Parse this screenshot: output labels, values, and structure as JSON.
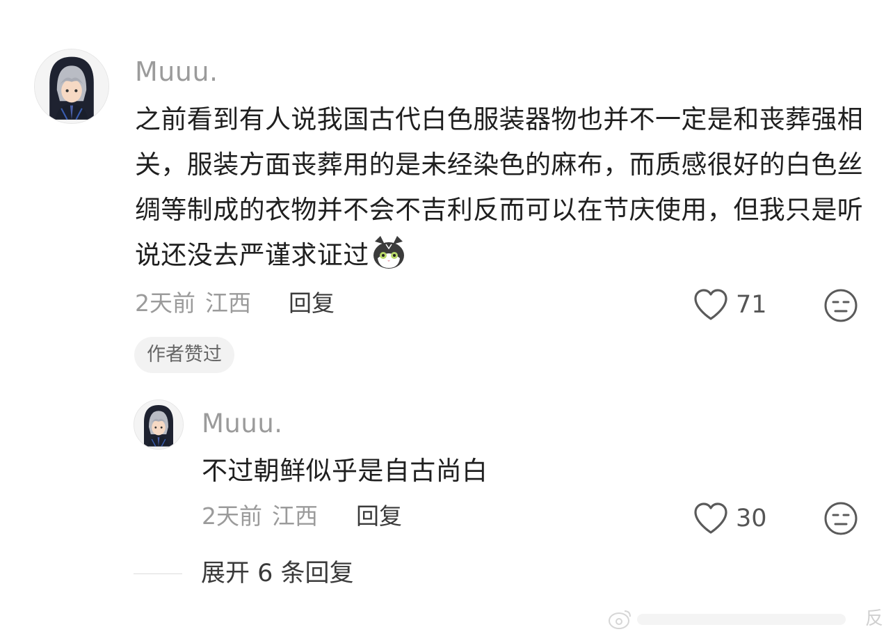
{
  "comment": {
    "username": "Muuu.",
    "text": "之前看到有人说我国古代白色服装器物也并不一定是和丧葬强相关，服装方面丧葬用的是未经染色的麻布，而质感很好的白色丝绸等制成的衣物并不会不吉利反而可以在节庆使用，但我只是听说还没去严谨求证过",
    "emoji": "cat-emoji",
    "time": "2天前",
    "location": "江西",
    "reply_label": "回复",
    "likes": "71",
    "badge": "作者赞过"
  },
  "reply": {
    "username": "Muuu.",
    "text": "不过朝鲜似乎是自古尚白",
    "time": "2天前",
    "location": "江西",
    "reply_label": "回复",
    "likes": "30"
  },
  "expand": {
    "label": "展开 6 条回复"
  },
  "watermark": {
    "text": "反"
  },
  "colors": {
    "secondary_text": "#9b9b9b",
    "badge_bg": "#f2f2f2",
    "primary_text": "#1f1f1f"
  }
}
